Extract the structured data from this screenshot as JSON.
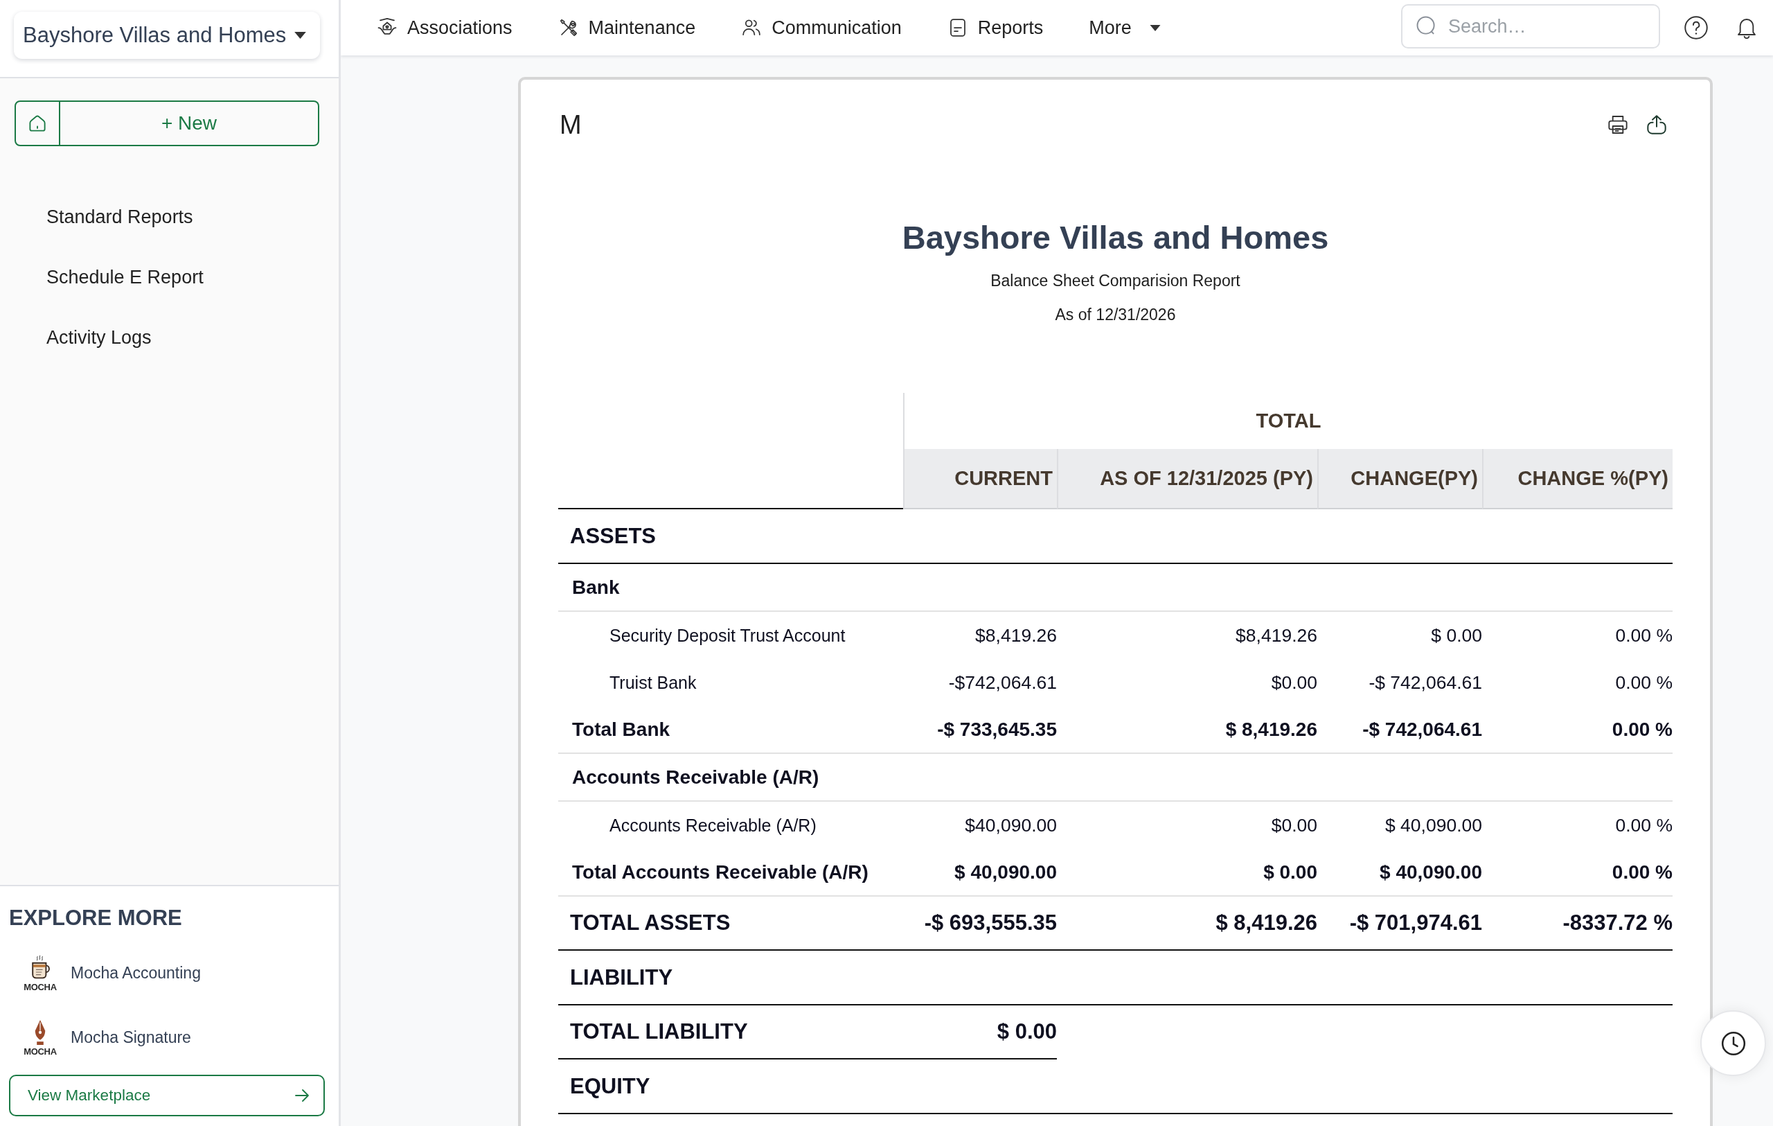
{
  "sidebar": {
    "property_selector": "Bayshore Villas and Homes",
    "new_button": "+ New",
    "menu": [
      "Standard Reports",
      "Schedule E Report",
      "Activity Logs"
    ],
    "explore": {
      "title": "EXPLORE MORE",
      "items": [
        {
          "kind": "cup",
          "logo_text": "MOCHA",
          "name": "Mocha Accounting"
        },
        {
          "kind": "pen",
          "logo_text": "MOCHA",
          "name": "Mocha Signature"
        }
      ],
      "button": "View Marketplace"
    }
  },
  "top_nav": {
    "items": [
      {
        "kind": "associations",
        "label": "Associations"
      },
      {
        "kind": "maintenance",
        "label": "Maintenance"
      },
      {
        "kind": "communication",
        "label": "Communication"
      },
      {
        "kind": "reports",
        "label": "Reports"
      },
      {
        "kind": "dropdown",
        "label": "More"
      }
    ],
    "search": {
      "placeholder": "Search…"
    }
  },
  "report": {
    "logo": "M",
    "title": "Bayshore Villas and Homes",
    "subtitle": "Balance Sheet Comparision Report",
    "as_of": "As of 12/31/2026",
    "table": {
      "group_header": "TOTAL",
      "columns": [
        "CURRENT",
        "AS OF 12/31/2025 (PY)",
        "CHANGE(PY)",
        "CHANGE %(PY)"
      ],
      "sections": [
        {
          "title": "ASSETS",
          "groups": [
            {
              "title": "Bank",
              "accounts": [
                {
                  "label": "Security Deposit Trust Account",
                  "values": [
                    "$8,419.26",
                    "$8,419.26",
                    "$ 0.00",
                    "0.00 %"
                  ]
                },
                {
                  "label": "Truist Bank",
                  "values": [
                    "-$742,064.61",
                    "$0.00",
                    "-$ 742,064.61",
                    "0.00 %"
                  ]
                }
              ],
              "total": {
                "label": "Total Bank",
                "values": [
                  "-$ 733,645.35",
                  "$ 8,419.26",
                  "-$ 742,064.61",
                  "0.00 %"
                ]
              }
            },
            {
              "title": "Accounts Receivable (A/R)",
              "accounts": [
                {
                  "label": "Accounts Receivable (A/R)",
                  "values": [
                    "$40,090.00",
                    "$0.00",
                    "$ 40,090.00",
                    "0.00 %"
                  ]
                }
              ],
              "total": {
                "label": "Total Accounts Receivable (A/R)",
                "values": [
                  "$ 40,090.00",
                  "$ 0.00",
                  "$ 40,090.00",
                  "0.00 %"
                ]
              }
            }
          ],
          "total": {
            "label": "TOTAL ASSETS",
            "values": [
              "-$ 693,555.35",
              "$ 8,419.26",
              "-$ 701,974.61",
              "-8337.72 %"
            ]
          }
        },
        {
          "title": "LIABILITY",
          "total": {
            "label": "TOTAL LIABILITY",
            "values": [
              "$ 0.00"
            ]
          }
        },
        {
          "title": "EQUITY"
        }
      ]
    }
  }
}
